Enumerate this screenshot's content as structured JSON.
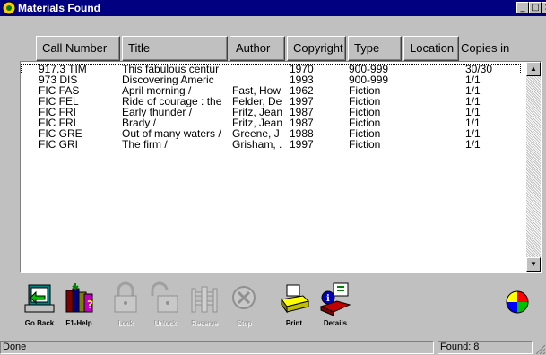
{
  "window": {
    "title": "Materials Found"
  },
  "columns": [
    {
      "label": "Call Number",
      "accel": "N"
    },
    {
      "label": "Title",
      "accel": "T"
    },
    {
      "label": "Author",
      "accel": "A"
    },
    {
      "label": "Copyright",
      "accel": "r"
    },
    {
      "label": "Type",
      "accel": "y"
    },
    {
      "label": "Location",
      "accel": "o"
    },
    {
      "label": "Copies in"
    }
  ],
  "rows": [
    {
      "call": "917.3 TIM",
      "title": "This fabulous centur",
      "author": "",
      "year": "1970",
      "type": "900-999",
      "copies": "30/30"
    },
    {
      "call": "973 DIS",
      "title": "Discovering Americ",
      "author": "",
      "year": "1993",
      "type": "900-999",
      "copies": "1/1"
    },
    {
      "call": "FIC FAS",
      "title": "April morning /",
      "author": "Fast, How",
      "year": "1962",
      "type": "Fiction",
      "copies": "1/1"
    },
    {
      "call": "FIC FEL",
      "title": "Ride of courage : the",
      "author": "Felder, De",
      "year": "1997",
      "type": "Fiction",
      "copies": "1/1"
    },
    {
      "call": "FIC FRI",
      "title": "Early thunder /",
      "author": "Fritz, Jean",
      "year": "1987",
      "type": "Fiction",
      "copies": "1/1"
    },
    {
      "call": "FIC FRI",
      "title": "Brady /",
      "author": "Fritz, Jean",
      "year": "1987",
      "type": "Fiction",
      "copies": "1/1"
    },
    {
      "call": "FIC GRE",
      "title": "Out of many waters /",
      "author": "Greene, J",
      "year": "1988",
      "type": "Fiction",
      "copies": "1/1"
    },
    {
      "call": "FIC GRI",
      "title": "The firm /",
      "author": "Grisham, .",
      "year": "1997",
      "type": "Fiction",
      "copies": "1/1"
    }
  ],
  "toolbar": {
    "go_back": "Go Back",
    "f1_help": "F1-Help",
    "look": "Look",
    "unlock": "Unlock",
    "reserve": "Reserve",
    "stop": "Stop",
    "print": "Print",
    "details": "Details"
  },
  "status": {
    "left": "Done",
    "right": "Found: 8"
  },
  "colors": {
    "titlebar": "#000080",
    "face": "#c0c0c0",
    "list_bg": "#ffffff"
  }
}
